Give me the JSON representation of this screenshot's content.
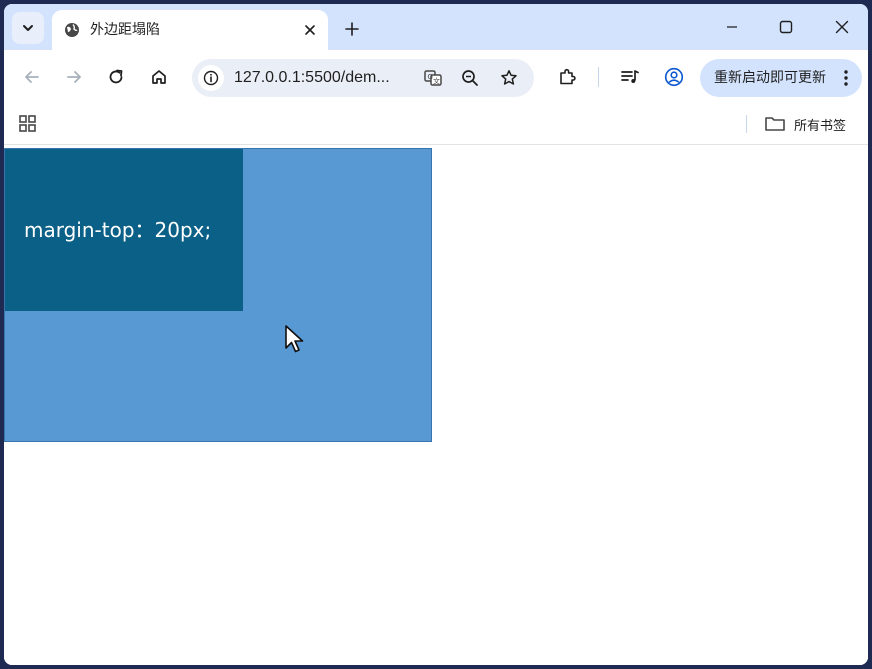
{
  "tab": {
    "title": "外边距塌陷",
    "favicon": "globe-icon"
  },
  "toolbar": {
    "url": "127.0.0.1:5500/dem...",
    "update_label": "重新启动即可更新"
  },
  "bookmarks": {
    "folder_label": "所有书签"
  },
  "page": {
    "son_text": "margin-top：20px;"
  },
  "colors": {
    "tabstrip": "#d3e3fd",
    "father_box": "#5898d3",
    "son_box": "#0a6086",
    "accent_icon": "#0b57d0"
  }
}
